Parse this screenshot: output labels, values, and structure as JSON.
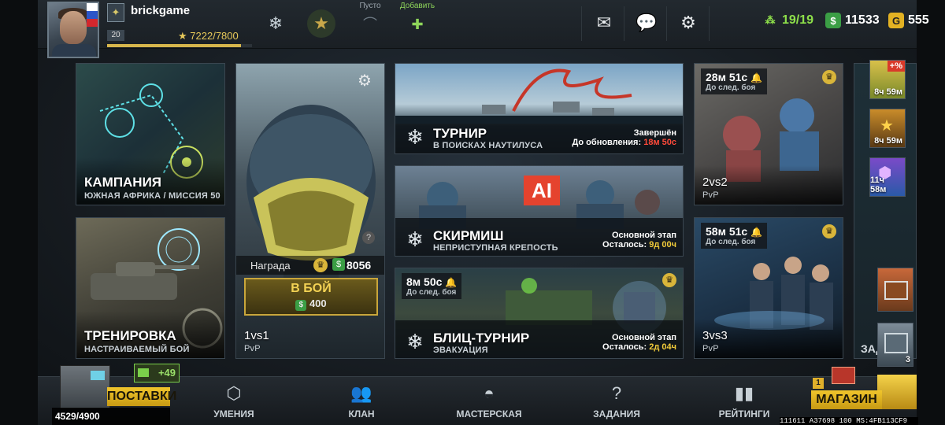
{
  "player": {
    "name": "brickgame",
    "level": "20",
    "xp": "7222/7800",
    "xp_fraction": 0.926
  },
  "slots": [
    {
      "label": "Пусто"
    },
    {
      "label": "Добавить"
    }
  ],
  "resources": {
    "energy": "19/19",
    "money": "11533",
    "gold": "555"
  },
  "cards": {
    "campaign": {
      "title": "КАМПАНИЯ",
      "subtitle": "ЮЖНАЯ АФРИКА / МИССИЯ 50"
    },
    "training": {
      "title": "ТРЕНИРОВКА",
      "subtitle": "НАСТРАИВАЕМЫЙ БОЙ"
    },
    "pvp1": {
      "reward_label": "Награда",
      "reward_value": "8056",
      "button": "В БОЙ",
      "cost": "400",
      "mode": "1vs1",
      "type": "PvP",
      "help": "?"
    },
    "tournament": {
      "title": "ТУРНИР",
      "subtitle": "В ПОИСКАХ НАУТИЛУСА",
      "status": "Завершён",
      "update_label": "До обновления:",
      "update_time": "18м 50с"
    },
    "skirmish": {
      "title": "СКИРМИШ",
      "subtitle": "НЕПРИСТУПНАЯ КРЕПОСТЬ",
      "stage": "Основной этап",
      "left_label": "Осталось:",
      "left_time": "9д 00ч",
      "ai": "AI"
    },
    "blitz": {
      "timer": "8м 50с",
      "timer_label": "До след. боя",
      "title": "БЛИЦ-ТУРНИР",
      "subtitle": "ЭВАКУАЦИЯ",
      "stage": "Основной этап",
      "left_label": "Осталось:",
      "left_time": "2д 04ч"
    },
    "pvp2": {
      "timer": "28м 51с",
      "timer_label": "До след. боя",
      "mode": "2vs2",
      "type": "PvP"
    },
    "pvp3": {
      "timer": "58м 51с",
      "timer_label": "До след. боя",
      "mode": "3vs3",
      "type": "PvP"
    }
  },
  "side_offers": [
    {
      "time": "8ч 59м",
      "tag": "+%"
    },
    {
      "time": "8ч 59м"
    },
    {
      "time": "11ч 58м"
    }
  ],
  "side_partial": "ЗАД",
  "crate_count": "3",
  "supplies": {
    "label": "ПОСТАВКИ",
    "count": "4529/4900",
    "bonus": "+49"
  },
  "nav": [
    {
      "label": "УМЕНИЯ"
    },
    {
      "label": "КЛАН"
    },
    {
      "label": "МАСТЕРСКАЯ"
    },
    {
      "label": "ЗАДАНИЯ"
    },
    {
      "label": "РЕЙТИНГИ"
    }
  ],
  "shop": {
    "label": "МАГАЗИН",
    "badge": "1"
  },
  "debug": "111611 A37698 100 MS:4FB113CF9"
}
